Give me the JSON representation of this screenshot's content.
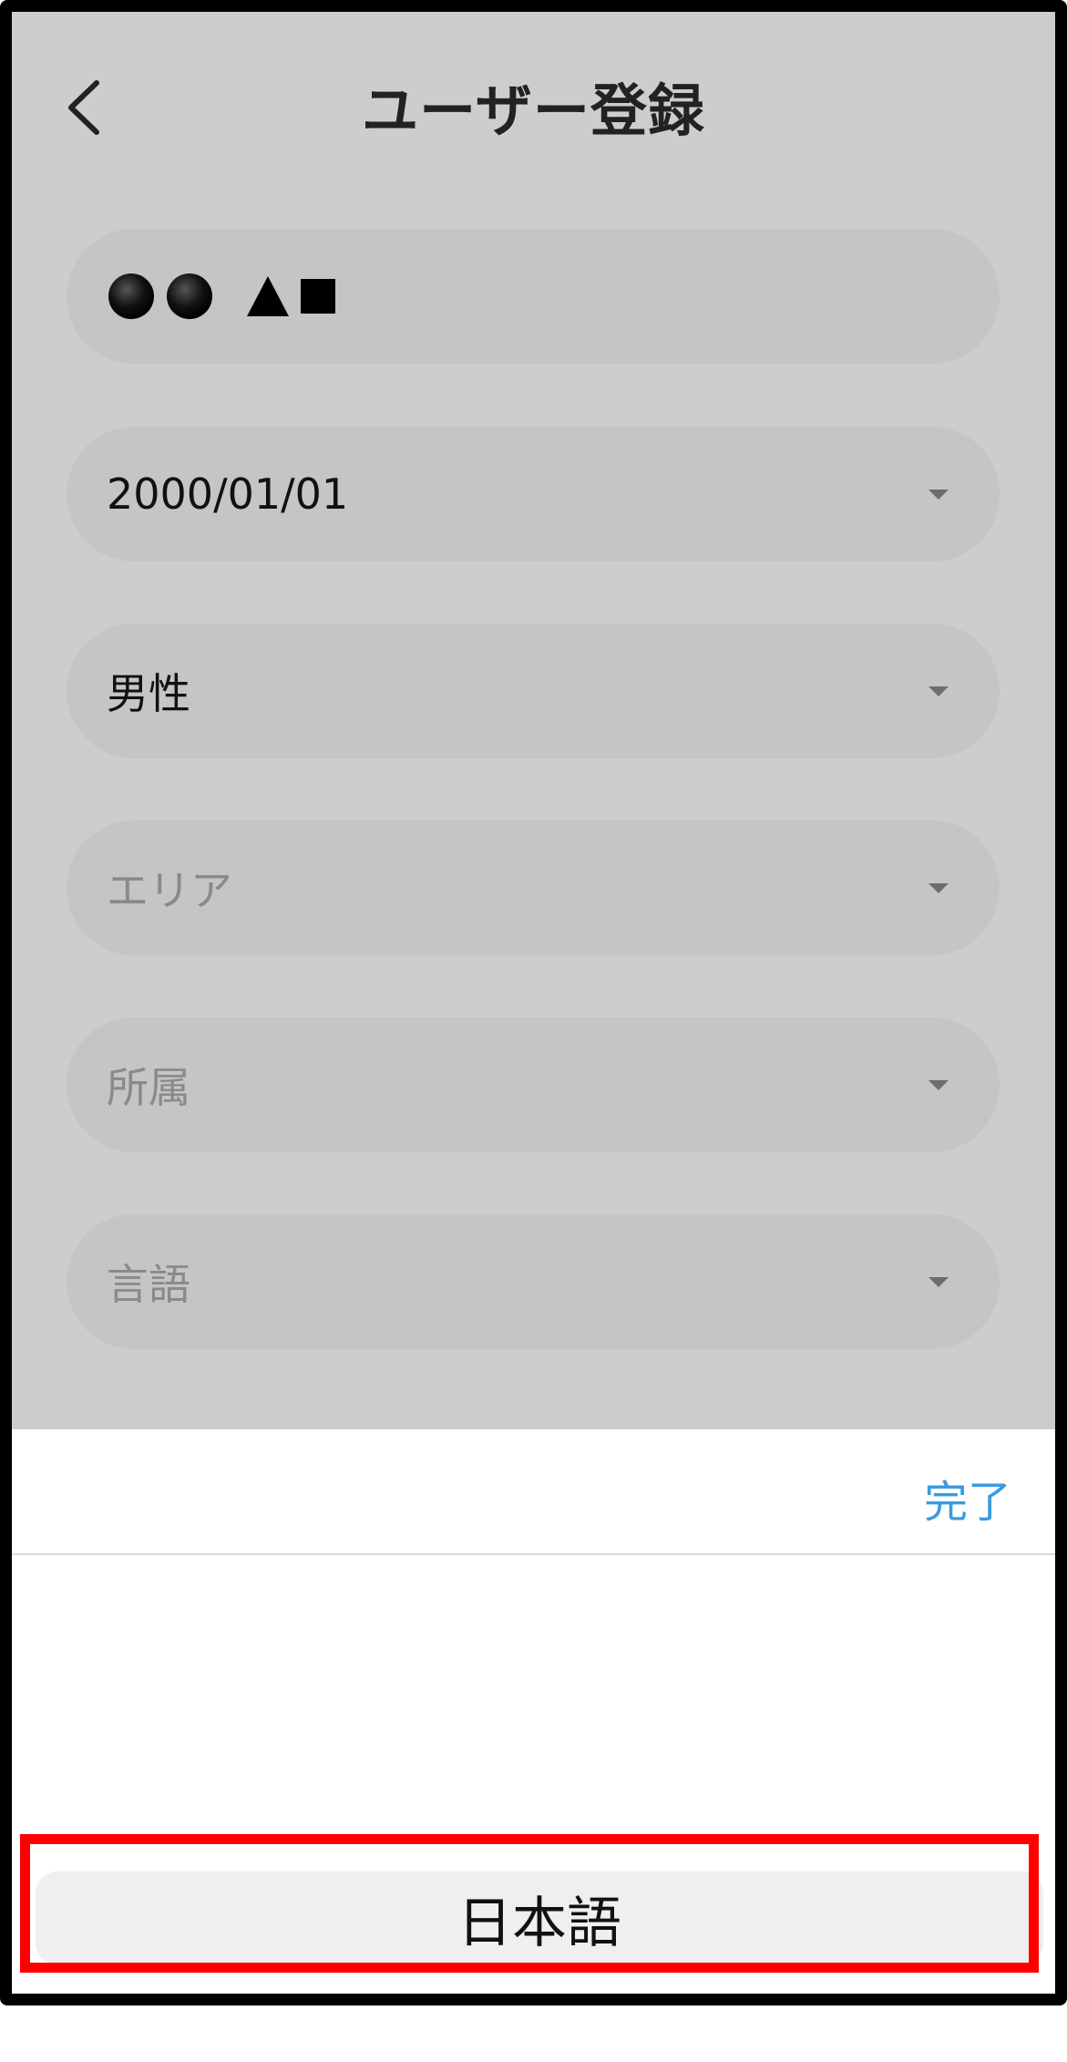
{
  "header": {
    "title": "ユーザー登録",
    "back_icon": "chevron-left-icon"
  },
  "form": {
    "name_field": {
      "value_shapes": [
        "circle",
        "circle",
        "triangle",
        "square"
      ]
    },
    "birthdate_field": {
      "value": "2000/01/01"
    },
    "gender_field": {
      "value": "男性"
    },
    "area_field": {
      "placeholder": "エリア"
    },
    "affiliation_field": {
      "placeholder": "所属"
    },
    "language_field": {
      "placeholder": "言語"
    }
  },
  "picker": {
    "done_label": "完了",
    "options": [
      "日本語"
    ],
    "selected": "日本語"
  },
  "colors": {
    "overlay": "#cdcdcd",
    "field": "#c5c5c5",
    "done": "#3a9be0",
    "highlight": "#ff0000"
  }
}
